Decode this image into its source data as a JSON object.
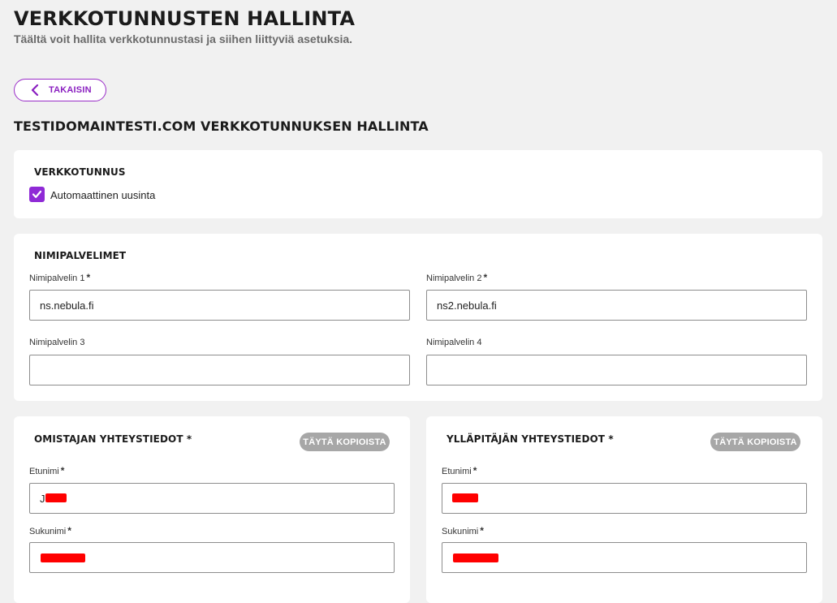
{
  "header": {
    "title": "VERKKOTUNNUSTEN HALLINTA",
    "subtitle": "Täältä voit hallita verkkotunnustasi ja siihen liittyviä asetuksia."
  },
  "back_button": {
    "label": "TAKAISIN",
    "icon": "chevron-left-icon"
  },
  "domain_heading": "TESTIDOMAINTESTI.COM VERKKOTUNNUKSEN HALLINTA",
  "domain_card": {
    "title": "VERKKOTUNNUS",
    "auto_renew": {
      "label": "Automaattinen uusinta",
      "checked": true
    }
  },
  "nameservers": {
    "title": "NIMIPALVELIMET",
    "fields": [
      {
        "label": "Nimipalvelin 1",
        "required": "*",
        "value": "ns.nebula.fi"
      },
      {
        "label": "Nimipalvelin 2",
        "required": "*",
        "value": "ns2.nebula.fi"
      },
      {
        "label": "Nimipalvelin 3",
        "required": "",
        "value": ""
      },
      {
        "label": "Nimipalvelin 4",
        "required": "",
        "value": ""
      }
    ]
  },
  "owner_contact": {
    "title": "OMISTAJAN YHTEYSTIEDOT *",
    "fill_button": "TÄYTÄ KOPIOISTA",
    "first_name": {
      "label": "Etunimi",
      "required": "*",
      "value": "J"
    },
    "last_name": {
      "label": "Sukunimi",
      "required": "*",
      "value": ""
    }
  },
  "admin_contact": {
    "title": "YLLÄPITÄJÄN YHTEYSTIEDOT *",
    "fill_button": "TÄYTÄ KOPIOISTA",
    "first_name": {
      "label": "Etunimi",
      "required": "*",
      "value": ""
    },
    "last_name": {
      "label": "Sukunimi",
      "required": "*",
      "value": ""
    }
  },
  "colors": {
    "accent": "#8f2ad6",
    "background": "#f1f1f1",
    "redaction": "#ff0000"
  }
}
